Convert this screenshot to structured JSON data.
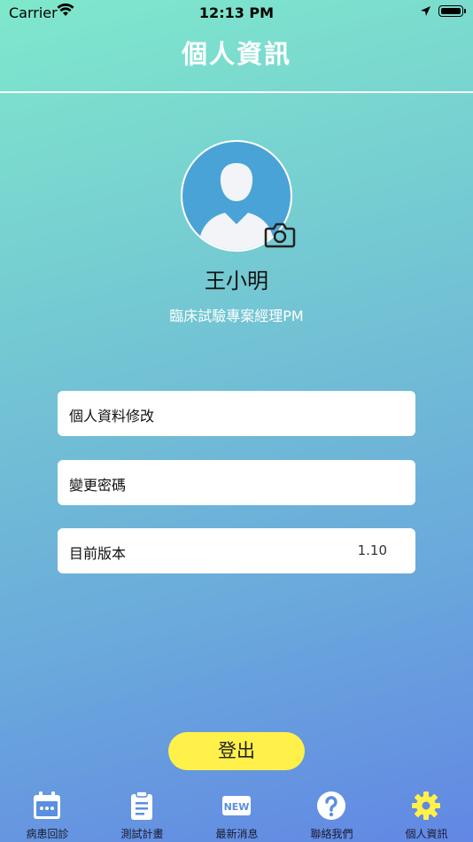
{
  "status_bar": {
    "carrier": "Carrier",
    "time": "12:13 PM"
  },
  "header": {
    "title": "個人資訊"
  },
  "profile": {
    "name": "王小明",
    "job_title": "臨床試驗專案經理PM"
  },
  "menu": {
    "edit_profile": "個人資料修改",
    "change_password": "變更密碼",
    "version_label": "目前版本",
    "version_value": "1.10"
  },
  "logout_label": "登出",
  "tabs": [
    {
      "label": "病患回診",
      "icon": "calendar-icon",
      "active": false
    },
    {
      "label": "測試計畫",
      "icon": "clipboard-icon",
      "active": false
    },
    {
      "label": "最新消息",
      "icon": "new-badge-icon",
      "badge_text": "NEW",
      "active": false
    },
    {
      "label": "聯絡我們",
      "icon": "help-icon",
      "active": false
    },
    {
      "label": "個人資訊",
      "icon": "gear-icon",
      "active": true
    }
  ],
  "colors": {
    "tab_icon": "#ffffff",
    "tab_icon_active": "#fff14a",
    "logout_button": "#fff14a",
    "avatar_bg": "#4aa3d6"
  }
}
